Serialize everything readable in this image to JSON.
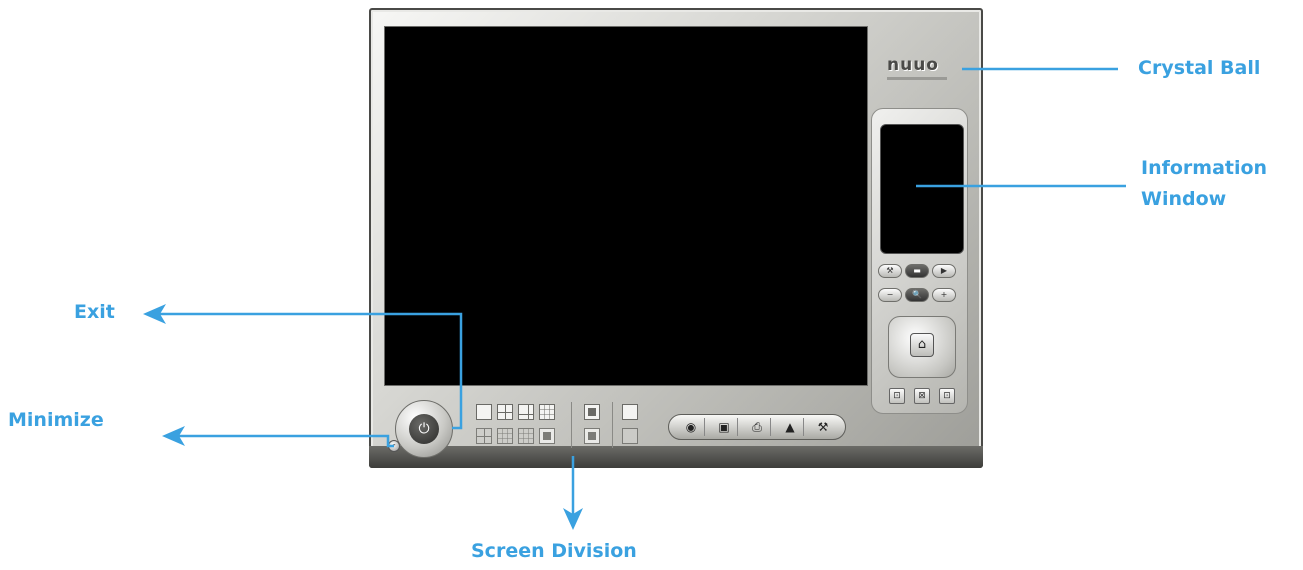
{
  "annotations": {
    "crystal_ball": "Crystal Ball",
    "information_window_line1": "Information",
    "information_window_line2": "Window",
    "exit": "Exit",
    "minimize": "Minimize",
    "screen_division": "Screen Division"
  },
  "app": {
    "logo_text": "nuuo",
    "power_symbol": "⏻",
    "minimize_symbol": "-"
  },
  "side_panel": {
    "row1": [
      "⚒",
      "▬",
      "▶"
    ],
    "row2": [
      "−",
      "🔍",
      "+"
    ],
    "ptz_home": "⌂",
    "bottom_buttons": [
      "⊡",
      "⊠",
      "⊡"
    ]
  },
  "toolbar": {
    "buttons": [
      "◉",
      "▣",
      "⎙",
      "▲",
      "⚒"
    ]
  },
  "colors": {
    "accent": "#3aa1e0",
    "frame": "#b9b9b4",
    "screen": "#000000"
  }
}
